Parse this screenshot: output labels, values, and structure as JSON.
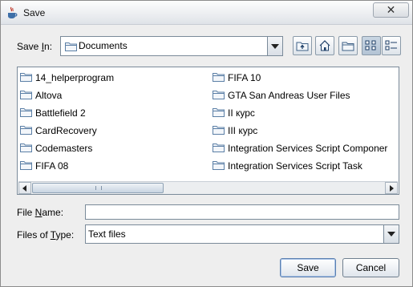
{
  "window": {
    "title": "Save",
    "close_symbol": "✕",
    "app_icon": "java-cup-icon"
  },
  "save_in": {
    "label_pre": "Save ",
    "label_mnemonic": "I",
    "label_post": "n:",
    "value": "Documents",
    "icon": "folder-icon"
  },
  "toolbar": {
    "up_icon": "up-one-level-icon",
    "home_icon": "home-icon",
    "new_folder_icon": "new-folder-icon",
    "list_icon": "list-view-icon",
    "details_icon": "details-view-icon",
    "selected_view": "list"
  },
  "files": {
    "column1": [
      "14_helperprogram",
      "Altova",
      "Battlefield 2",
      "CardRecovery",
      "Codemasters",
      "FIFA 08"
    ],
    "column2": [
      "FIFA 10",
      "GTA San Andreas User Files",
      "II курс",
      "III курс",
      "Integration Services Script Componer",
      "Integration Services Script Task"
    ]
  },
  "file_name": {
    "label_pre": "File ",
    "label_mnemonic": "N",
    "label_post": "ame:",
    "value": ""
  },
  "file_type": {
    "label_pre": "Files of ",
    "label_mnemonic": "T",
    "label_post": "ype:",
    "value": "Text files"
  },
  "buttons": {
    "save": "Save",
    "cancel": "Cancel"
  },
  "colors": {
    "window_bg": "#eeeeee",
    "border": "#7a8a99",
    "folder": "#5b7fa6"
  }
}
